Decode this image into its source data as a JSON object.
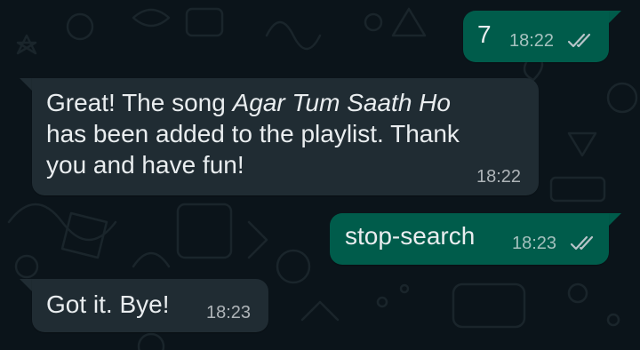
{
  "chat": {
    "messages": [
      {
        "direction": "outgoing",
        "text": "7",
        "time": "18:22",
        "status": "read",
        "status_icon": "double-check-icon"
      },
      {
        "direction": "incoming",
        "text_parts": {
          "before": "Great! The song ",
          "song_title": "Agar Tum Saath Ho",
          "line2": "has been added to the playlist. Thank",
          "line3": "you and have fun!"
        },
        "time": "18:22"
      },
      {
        "direction": "outgoing",
        "text": "stop-search",
        "time": "18:23",
        "status": "read",
        "status_icon": "double-check-icon"
      },
      {
        "direction": "incoming",
        "text": "Got it. Bye!",
        "time": "18:23"
      }
    ]
  },
  "colors": {
    "background": "#0b141a",
    "outgoing_bubble": "#005c4b",
    "incoming_bubble": "#202c33",
    "text": "#e9edef",
    "tick": "#b8c4c9"
  }
}
